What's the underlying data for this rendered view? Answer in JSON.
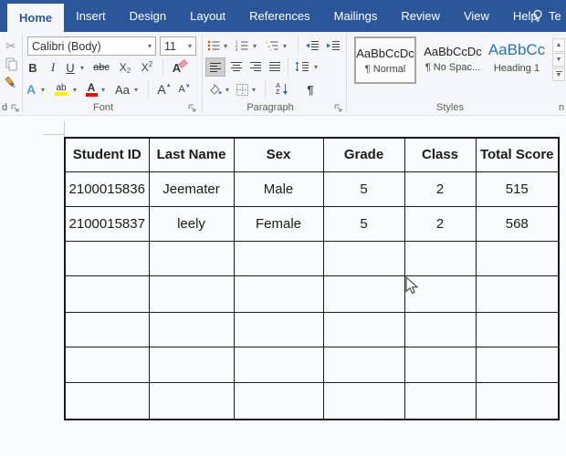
{
  "accent": "#2B579A",
  "tabbar": {
    "tabs": [
      {
        "label": "Home",
        "active": true
      },
      {
        "label": "Insert",
        "active": false
      },
      {
        "label": "Design",
        "active": false
      },
      {
        "label": "Layout",
        "active": false
      },
      {
        "label": "References",
        "active": false
      },
      {
        "label": "Mailings",
        "active": false
      },
      {
        "label": "Review",
        "active": false
      },
      {
        "label": "View",
        "active": false
      },
      {
        "label": "Help",
        "active": false
      }
    ],
    "tell_me_label": "Te"
  },
  "ribbon": {
    "clipboard": {
      "label_fragment": "d"
    },
    "font": {
      "group_label": "Font",
      "font_name_value": "Calibri (Body)",
      "font_size_value": "11",
      "bold_label": "B",
      "italic_label": "I",
      "underline_label": "U",
      "strikethrough_label": "abc",
      "subscript_base": "X",
      "subscript_digit": "2",
      "superscript_base": "X",
      "superscript_digit": "2",
      "text_effects_label": "A",
      "highlight_label": "ab",
      "font_color_label": "A",
      "change_case_label": "Aa",
      "grow_font_label": "A",
      "shrink_font_label": "A"
    },
    "paragraph": {
      "group_label": "Paragraph",
      "sort_a": "A",
      "sort_z": "Z",
      "pilcrow": "¶"
    },
    "styles": {
      "group_label": "Styles",
      "items": [
        {
          "preview": "AaBbCcDc",
          "name": "¶ Normal",
          "selected": true,
          "heading": false
        },
        {
          "preview": "AaBbCcDc",
          "name": "¶ No Spac...",
          "selected": false,
          "heading": false
        },
        {
          "preview": "AaBbCc",
          "name": "Heading 1",
          "selected": false,
          "heading": true
        }
      ]
    },
    "next_group_fragment": "n"
  },
  "document": {
    "table": {
      "headers": [
        "Student ID",
        "Last Name",
        "Sex",
        "Grade",
        "Class",
        "Total Score"
      ],
      "rows": [
        [
          "2100015836",
          "Jeemater",
          "Male",
          "5",
          "2",
          "515"
        ],
        [
          "2100015837",
          "leely",
          "Female",
          "5",
          "2",
          "568"
        ],
        [
          "",
          "",
          "",
          "",
          "",
          ""
        ],
        [
          "",
          "",
          "",
          "",
          "",
          ""
        ],
        [
          "",
          "",
          "",
          "",
          "",
          ""
        ],
        [
          "",
          "",
          "",
          "",
          "",
          ""
        ],
        [
          "",
          "",
          "",
          "",
          "",
          ""
        ]
      ]
    }
  },
  "colors": {
    "heading_style_text": "#2E74B5",
    "highlight_yellow": "#FFF000",
    "font_color_red": "#FF0000",
    "titlebar_blue": "#2B579A"
  }
}
